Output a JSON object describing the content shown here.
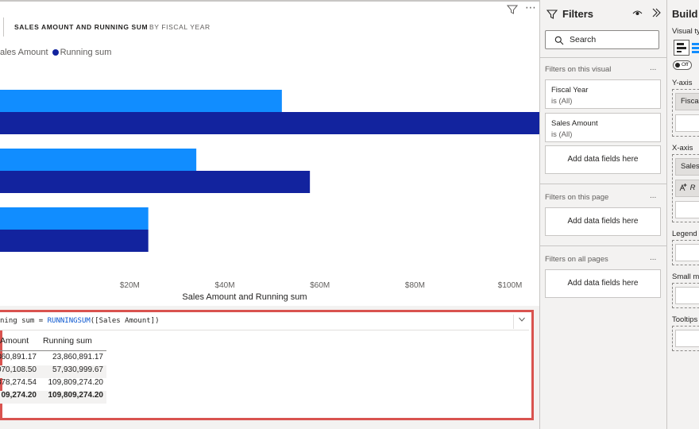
{
  "visual": {
    "title": "SALES AMOUNT AND RUNNING SUM",
    "subtitle": "BY FISCAL YEAR",
    "filter_icon": "filter-icon",
    "more_icon": "more-options-icon"
  },
  "legend": {
    "items": [
      {
        "label": "ales Amount",
        "color": "#118dff"
      },
      {
        "label": "Running sum",
        "color": "#12239e"
      }
    ]
  },
  "chart_data": {
    "type": "bar",
    "orientation": "horizontal",
    "categories": [
      "",
      "",
      ""
    ],
    "series": [
      {
        "name": "Sales Amount",
        "color": "#118dff",
        "values": [
          52,
          34,
          23.9
        ]
      },
      {
        "name": "Running sum",
        "color": "#12239e",
        "values": [
          109.8,
          57.9,
          23.9
        ]
      }
    ],
    "x_ticks": [
      {
        "value": 20,
        "label": "$20M"
      },
      {
        "value": 40,
        "label": "$40M"
      },
      {
        "value": 60,
        "label": "$60M"
      },
      {
        "value": 80,
        "label": "$80M"
      },
      {
        "value": 100,
        "label": "$100M"
      }
    ],
    "xlim": [
      -7.3,
      105
    ],
    "xlabel": "Sales Amount and Running sum",
    "ylabel": "",
    "grid": false,
    "legend_position": "top-left"
  },
  "dax": {
    "prefix": "ning sum = ",
    "function": "RUNNINGSUM",
    "args": "([Sales Amount])",
    "expand_icon": "chevron-down-icon"
  },
  "table": {
    "headers": [
      "Amount",
      "Running sum"
    ],
    "rows": [
      [
        "860,891.17",
        "23,860,891.17"
      ],
      [
        "070,108.50",
        "57,930,999.67"
      ],
      [
        "878,274.54",
        "109,809,274.20"
      ]
    ],
    "total": [
      "09,274.20",
      "109,809,274.20"
    ]
  },
  "filters": {
    "title": "Filters",
    "eye_icon": "eye-icon",
    "collapse_icon": "double-chevron-right-icon",
    "search_placeholder": "Search",
    "visual_section": "Filters on this visual",
    "cards": [
      {
        "name": "Fiscal Year",
        "value": "is (All)"
      },
      {
        "name": "Sales Amount",
        "value": "is (All)"
      }
    ],
    "add_fields": "Add data fields here",
    "page_section": "Filters on this page",
    "all_pages_section": "Filters on all pages",
    "more": "..."
  },
  "build": {
    "title": "Build",
    "visual_type_label": "Visual ty",
    "toggle_label": "Off",
    "yaxis_label": "Y-axis",
    "yaxis_field": "Fiscal",
    "xaxis_label": "X-axis",
    "xaxis_field1": "Sales",
    "xaxis_field2": "R",
    "legend_label": "Legend",
    "small_multiples_label": "Small m",
    "tooltips_label": "Tooltips"
  }
}
